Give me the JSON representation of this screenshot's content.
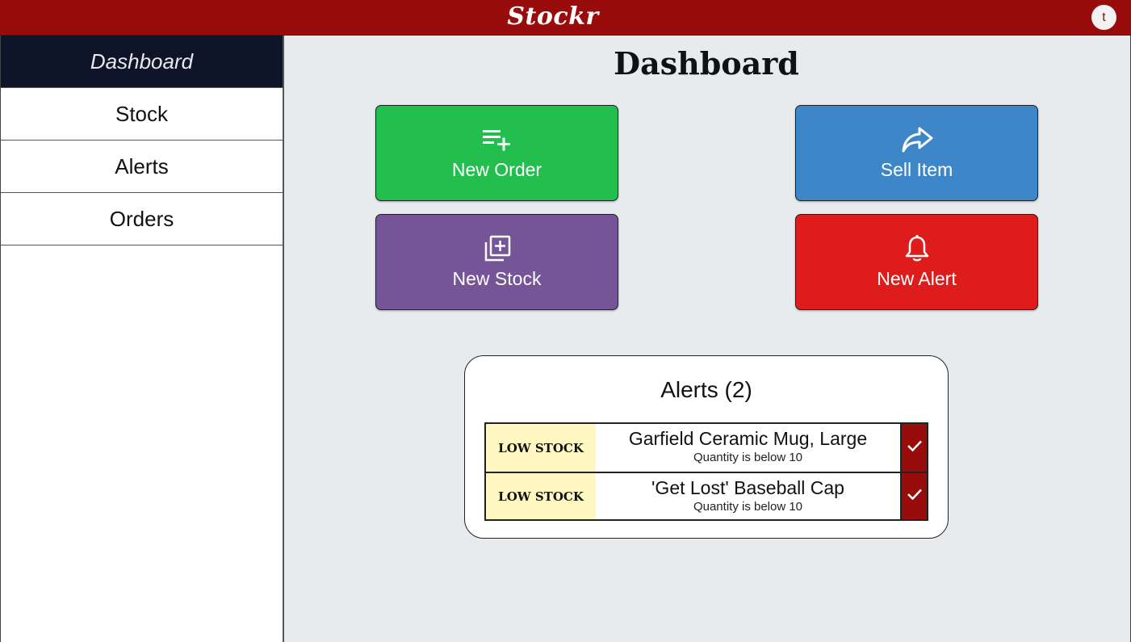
{
  "header": {
    "brand": "Stockr",
    "avatar_initial": "t",
    "bar_color": "#990c0c"
  },
  "sidebar": {
    "items": [
      {
        "label": "Dashboard",
        "active": true
      },
      {
        "label": "Stock",
        "active": false
      },
      {
        "label": "Alerts",
        "active": false
      },
      {
        "label": "Orders",
        "active": false
      }
    ]
  },
  "main": {
    "title": "Dashboard",
    "actions": [
      {
        "label": "New Order",
        "icon": "playlist-add-icon",
        "color": "#22bf4f"
      },
      {
        "label": "Sell Item",
        "icon": "share-arrow-icon",
        "color": "#3d86c8"
      },
      {
        "label": "New Stock",
        "icon": "library-add-icon",
        "color": "#755597"
      },
      {
        "label": "New Alert",
        "icon": "bell-icon",
        "color": "#df1c1c"
      }
    ],
    "alerts_panel": {
      "title": "Alerts (2)",
      "items": [
        {
          "type": "LOW STOCK",
          "name": "Garfield Ceramic Mug, Large",
          "description": "Quantity is below 10",
          "action_icon": "check-icon"
        },
        {
          "type": "LOW STOCK",
          "name": "'Get Lost' Baseball Cap",
          "description": "Quantity is below 10",
          "action_icon": "check-icon"
        }
      ]
    }
  }
}
